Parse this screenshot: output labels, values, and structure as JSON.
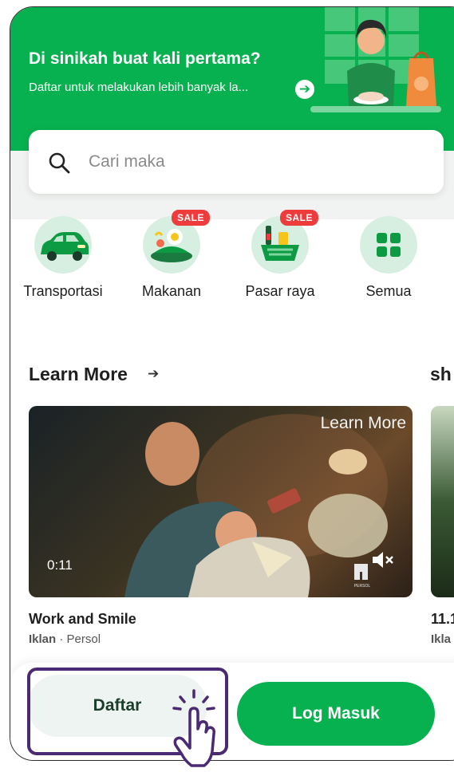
{
  "hero": {
    "title": "Di sinikah buat kali pertama?",
    "subtitle": "Daftar untuk melakukan lebih banyak la...",
    "arrow_icon": "arrow-right-icon",
    "bg_color": "#08b14f"
  },
  "search": {
    "placeholder": "Cari maka",
    "icon": "search-icon"
  },
  "services": [
    {
      "label": "Transportasi",
      "icon": "car-icon",
      "badge": ""
    },
    {
      "label": "Makanan",
      "icon": "food-icon",
      "badge": "SALE"
    },
    {
      "label": "Pasar raya",
      "icon": "grocery-icon",
      "badge": "SALE"
    },
    {
      "label": "Semua",
      "icon": "grid-icon",
      "badge": ""
    }
  ],
  "learn_more": {
    "title": "Learn More",
    "next_section_title": "sh",
    "cards": [
      {
        "video_time": "0:11",
        "overlay_text": "Learn More",
        "brand_logo": "PERSOL",
        "title": "Work and Smile",
        "sponsor_label": "Iklan",
        "sponsor": "Persol"
      },
      {
        "title": "11.1",
        "sponsor_label": "Ikla"
      }
    ]
  },
  "actions": {
    "register": "Daftar",
    "login": "Log Masuk"
  },
  "colors": {
    "accent": "#08b14f",
    "sale_badge": "#ee3b3b",
    "highlight": "#4a2a72"
  }
}
